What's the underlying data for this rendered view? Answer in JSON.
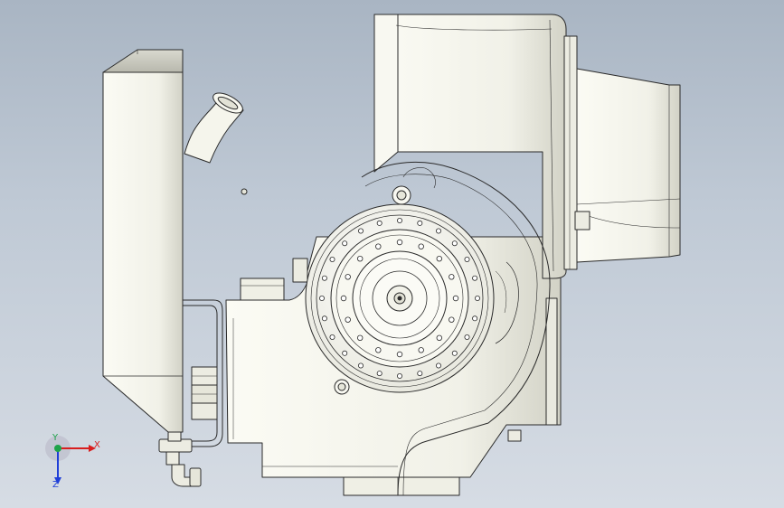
{
  "viewport": {
    "background_top": "#a9b5c3",
    "background_bottom": "#d6dce4",
    "model_fill": "#f3f3ea",
    "edge_color": "#2a2a2a",
    "shadow_color": "#c9c9bd"
  },
  "triad": {
    "x_label": "X",
    "y_label": "Y",
    "z_label": "Z",
    "x_color": "#d81e1e",
    "y_color": "#1fa34a",
    "z_color": "#1f3fd8"
  }
}
